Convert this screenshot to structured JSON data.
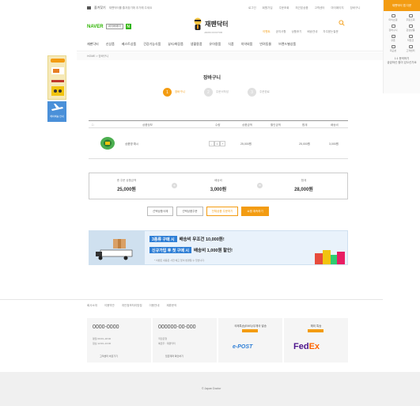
{
  "topbar": {
    "left_label": "즐겨찾기",
    "left_text": "재팬닥터를 즐겨찾기에 추가해 주세요",
    "links": [
      "로그인",
      "회원가입",
      "주문조회",
      "최근본상품",
      "고객센터",
      "마이페이지",
      "장바구니"
    ]
  },
  "app_card": {
    "header": "재팬닥터 앱 다운",
    "items": [
      "마이쇼핑",
      "주문조회",
      "장바구니",
      "관심상품",
      "쿠폰",
      "적립금",
      "최근본",
      "고객센터"
    ],
    "foot_1": "1:1 문의하기",
    "foot_2": "궁금하신 점이 있으신가요"
  },
  "naver": {
    "label": "NAVER",
    "pay": "네이버페이",
    "n": "N"
  },
  "brand": {
    "name": "재팬닥터",
    "sub": "JAPAN DOCTOR"
  },
  "quick_links": [
    "이벤트",
    "공지사항",
    "상품후기",
    "배송안내",
    "자주묻는질문"
  ],
  "nav": [
    "재팬닥터",
    "신상품",
    "베스트상품",
    "건강기능식품",
    "뷰티/화장품",
    "생활용품",
    "유아용품",
    "식품",
    "의약외품",
    "반려동물",
    "브랜드별상품"
  ],
  "breadcrumb": "HOME > 장바구니",
  "side_banners": {
    "first": "빠른 배송",
    "second": "해외배송 안내"
  },
  "page_title": "장바구니",
  "steps": [
    {
      "num": "1",
      "label": "장바구니"
    },
    {
      "num": "2",
      "label": "주문서작성"
    },
    {
      "num": "3",
      "label": "주문완료"
    }
  ],
  "cart": {
    "headers": [
      "상품정보",
      "수량",
      "상품금액",
      "할인금액",
      "합계",
      "배송비"
    ],
    "row": {
      "name": "상품명 예시",
      "qty_minus": "-",
      "qty": "1",
      "qty_plus": "+",
      "price": "25,000원",
      "total": "25,000원",
      "shipping": "3,000원"
    }
  },
  "totals": {
    "products_label": "총 주문 상품금액",
    "products_value": "25,000원",
    "plus": "+",
    "shipping_label": "배송비",
    "shipping_value": "3,000원",
    "equals": "=",
    "total_label": "합계",
    "total_value": "28,000원"
  },
  "buttons": [
    "선택상품삭제",
    "선택상품주문",
    "전체상품 주문하기",
    "쇼핑 계속하기"
  ],
  "promo": {
    "tag1": "3종류 구매 시",
    "line1": "배송비 무조건 10,000원!",
    "tag2": "신규가입 후 첫 구매 시",
    "line2": "배송비 1,000원 할인!",
    "note": "* 이벤트 내용은 사전 예고 없이 변경될 수 있습니다."
  },
  "footer_links": [
    "회사소개",
    "이용약관",
    "개인정보처리방침",
    "이용안내",
    "제휴문의"
  ],
  "footer": {
    "phone_1": "0000-0000",
    "phone_1_sub_1": "평일 09:00~18:00",
    "phone_1_sub_2": "점심 12:00~13:00",
    "phone_1_pill": "고객센터 바로가기",
    "phone_2": "000000-00-000",
    "phone_2_sub_1": "국민은행",
    "phone_2_sub_2": "예금주 : 재팬닥터",
    "phone_2_pill": "입금계좌 확인하기",
    "ship_1_label": "국제특송(EMS)/우체국 발송",
    "ship_1_logo": "e-POST",
    "ship_2_label": "해외 특송",
    "fedex_fe": "Fed",
    "fedex_ex": "Ex"
  },
  "bottom_text": "© Japan Doctor",
  "colors": {
    "accent": "#f39c12",
    "naver": "#2db400",
    "promo_blue": "#2f7fd6"
  }
}
